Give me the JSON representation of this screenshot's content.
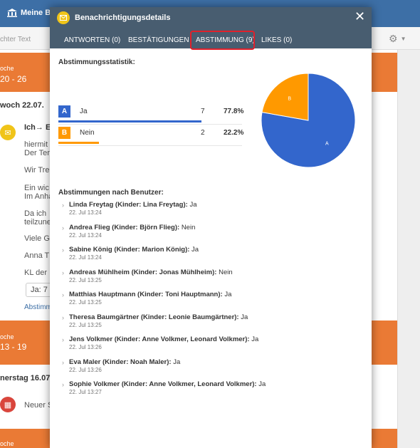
{
  "app": {
    "brand": "Meine Bib"
  },
  "background": {
    "search_placeholder": "chter Text",
    "week1": {
      "label": "oche",
      "range": "20 - 26"
    },
    "day1": "woch 22.07.",
    "item_title": "Ich→ E",
    "lines": [
      "hiermit",
      "Der Ten",
      "Wir Tre",
      "Ein wic",
      "Im Anha",
      "Da ich",
      "teilzune",
      "Viele G",
      "Anna T",
      "KL der"
    ],
    "pill": "Ja: 7",
    "link": "Abstimm",
    "week2": {
      "label": "oche",
      "range": "13 - 19"
    },
    "day2": "nerstag 16.07.",
    "item2": "Neuer S",
    "week3": {
      "label": "oche"
    }
  },
  "modal": {
    "title": "Benachrichtigungsdetails",
    "tabs": [
      {
        "label": "ANTWORTEN (0)"
      },
      {
        "label": "BESTÄTIGUNGEN"
      },
      {
        "label": "ABSTIMMUNG (9)"
      },
      {
        "label": "LIKES (0)"
      }
    ],
    "stats_title": "Abstimmungsstatistik:",
    "options": [
      {
        "key": "A",
        "label": "Ja",
        "count": "7",
        "percent": "77.8%",
        "fraction": 0.778,
        "color": "#3366cc"
      },
      {
        "key": "B",
        "label": "Nein",
        "count": "2",
        "percent": "22.2%",
        "fraction": 0.222,
        "color": "#ff9900"
      }
    ],
    "votes_title": "Abstimmungen nach Benutzer:",
    "votes": [
      {
        "name": "Linda Freytag (Kinder: Lina Freytag):",
        "answer": "Ja",
        "time": "22. Jul 13:24"
      },
      {
        "name": "Andrea Flieg (Kinder: Björn Flieg):",
        "answer": "Nein",
        "time": "22. Jul 13:24"
      },
      {
        "name": "Sabine König (Kinder: Marion König):",
        "answer": "Ja",
        "time": "22. Jul 13:24"
      },
      {
        "name": "Andreas Mühlheim (Kinder: Jonas Mühlheim):",
        "answer": "Nein",
        "time": "22. Jul 13:25"
      },
      {
        "name": "Matthias Hauptmann (Kinder: Toni Hauptmann):",
        "answer": "Ja",
        "time": "22. Jul 13:25"
      },
      {
        "name": "Theresa Baumgärtner (Kinder: Leonie Baumgärtner):",
        "answer": "Ja",
        "time": "22. Jul 13:25"
      },
      {
        "name": "Jens Volkmer (Kinder: Anne Volkmer, Leonard Volkmer):",
        "answer": "Ja",
        "time": "22. Jul 13:26"
      },
      {
        "name": "Eva Maler (Kinder: Noah Maler):",
        "answer": "Ja",
        "time": "22. Jul 13:26"
      },
      {
        "name": "Sophie Volkmer (Kinder: Anne Volkmer, Leonard Volkmer):",
        "answer": "Ja",
        "time": "22. Jul 13:27"
      }
    ]
  },
  "chart_data": {
    "type": "pie",
    "categories": [
      "A",
      "B"
    ],
    "values": [
      7,
      2
    ],
    "colors": [
      "#3366cc",
      "#ff9900"
    ]
  }
}
